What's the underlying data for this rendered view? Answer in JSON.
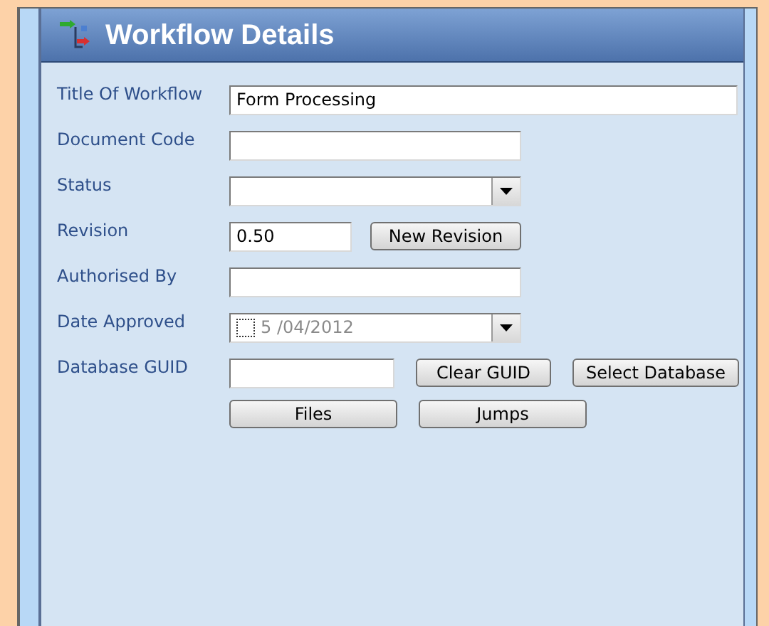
{
  "panel": {
    "title": "Workflow Details"
  },
  "fields": [
    {
      "label": "Title Of Workflow",
      "kind": "text",
      "value": "Form Processing"
    },
    {
      "label": "Document Code",
      "kind": "text"
    },
    {
      "label": "Status",
      "kind": "select"
    },
    {
      "label": "Revision",
      "kind": "text",
      "value": "0.50",
      "buttons": [
        "New Revision"
      ]
    },
    {
      "label": "Authorised By",
      "kind": "text"
    },
    {
      "label": "Date Approved",
      "kind": "date",
      "value": "5 /04/2012",
      "checked": false
    },
    {
      "label": "Database GUID",
      "kind": "text",
      "buttons": [
        "Clear GUID",
        "Select Database"
      ]
    }
  ],
  "actions": [
    "Files",
    "Jumps"
  ]
}
